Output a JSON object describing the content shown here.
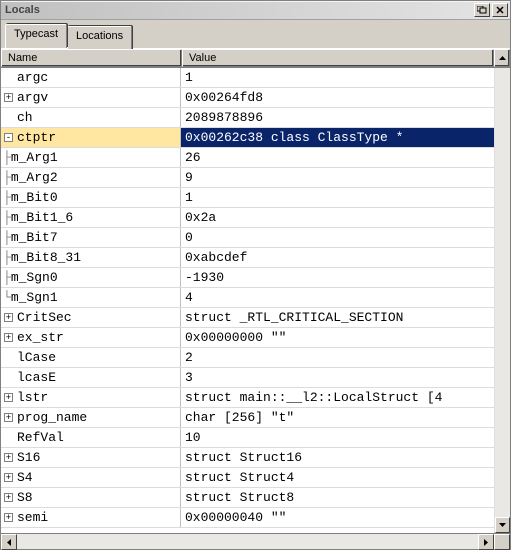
{
  "window": {
    "title": "Locals"
  },
  "tabs": [
    {
      "label": "Typecast",
      "active": true
    },
    {
      "label": "Locations",
      "active": false
    }
  ],
  "columns": {
    "name": "Name",
    "value": "Value"
  },
  "rows": [
    {
      "glyph": "",
      "indent": 14,
      "pre": "",
      "name": "argc",
      "value": "1"
    },
    {
      "glyph": "+",
      "indent": 0,
      "pre": "",
      "name": "argv",
      "value": "0x00264fd8"
    },
    {
      "glyph": "",
      "indent": 14,
      "pre": "",
      "name": "ch",
      "value": "2089878896"
    },
    {
      "glyph": "-",
      "indent": 0,
      "pre": "",
      "name": "ctptr",
      "value": "0x00262c38 class ClassType *",
      "selected": true
    },
    {
      "glyph": "",
      "indent": 0,
      "pre": "├  ",
      "name": "m_Arg1",
      "value": "26"
    },
    {
      "glyph": "",
      "indent": 0,
      "pre": "├  ",
      "name": "m_Arg2",
      "value": "9"
    },
    {
      "glyph": "",
      "indent": 0,
      "pre": "├  ",
      "name": "m_Bit0",
      "value": "1"
    },
    {
      "glyph": "",
      "indent": 0,
      "pre": "├  ",
      "name": "m_Bit1_6",
      "value": "0x2a"
    },
    {
      "glyph": "",
      "indent": 0,
      "pre": "├  ",
      "name": "m_Bit7",
      "value": "0"
    },
    {
      "glyph": "",
      "indent": 0,
      "pre": "├  ",
      "name": "m_Bit8_31",
      "value": "0xabcdef"
    },
    {
      "glyph": "",
      "indent": 0,
      "pre": "├  ",
      "name": "m_Sgn0",
      "value": "-1930"
    },
    {
      "glyph": "",
      "indent": 0,
      "pre": "└  ",
      "name": "m_Sgn1",
      "value": "4"
    },
    {
      "glyph": "+",
      "indent": 0,
      "pre": " ",
      "name": "CritSec",
      "value": "struct _RTL_CRITICAL_SECTION"
    },
    {
      "glyph": "+",
      "indent": 0,
      "pre": "",
      "name": "ex_str",
      "value": "0x00000000 \"\""
    },
    {
      "glyph": "",
      "indent": 14,
      "pre": "",
      "name": "lCase",
      "value": "2"
    },
    {
      "glyph": "",
      "indent": 14,
      "pre": "",
      "name": "lcasE",
      "value": "3"
    },
    {
      "glyph": "+",
      "indent": 0,
      "pre": "",
      "name": "lstr",
      "value": "struct main::__l2::LocalStruct [4"
    },
    {
      "glyph": "+",
      "indent": 0,
      "pre": "",
      "name": "prog_name",
      "value": "char [256] \"t\""
    },
    {
      "glyph": "",
      "indent": 14,
      "pre": "",
      "name": "RefVal",
      "value": "10"
    },
    {
      "glyph": "+",
      "indent": 0,
      "pre": "",
      "name": "S16",
      "value": "struct Struct16"
    },
    {
      "glyph": "+",
      "indent": 0,
      "pre": "",
      "name": "S4",
      "value": "struct Struct4"
    },
    {
      "glyph": "+",
      "indent": 0,
      "pre": "",
      "name": "S8",
      "value": "struct Struct8"
    },
    {
      "glyph": "+",
      "indent": 0,
      "pre": "",
      "name": "semi",
      "value": "0x00000040 \"\""
    }
  ]
}
